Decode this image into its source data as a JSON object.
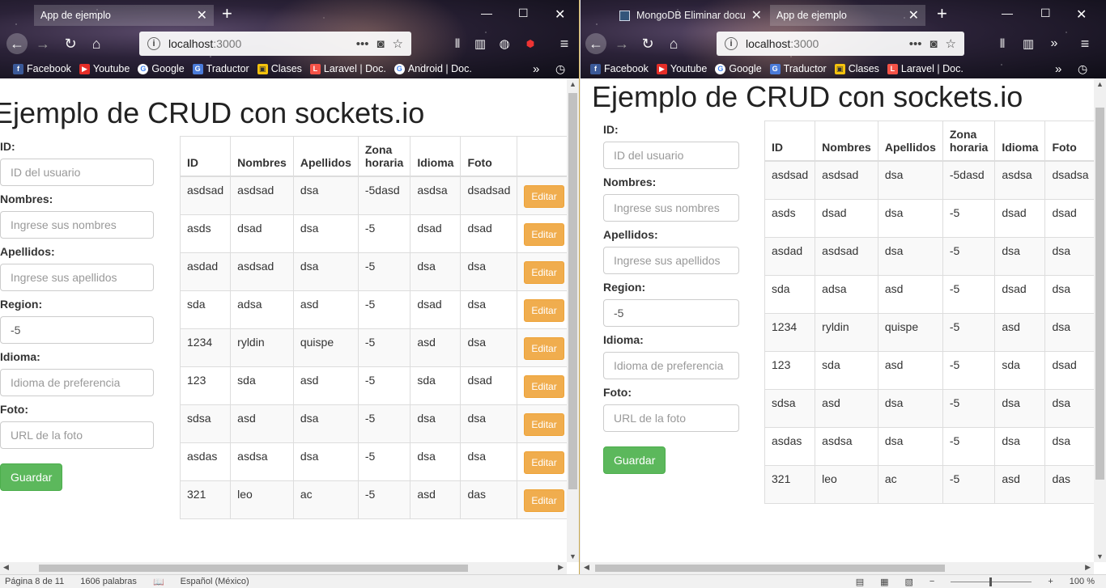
{
  "left": {
    "tab": {
      "label": "App de ejemplo"
    },
    "url": {
      "host": "localhost",
      "port": ":3000"
    }
  },
  "right": {
    "tabs": [
      {
        "label": "MongoDB Eliminar docu"
      },
      {
        "label": "App de ejemplo"
      }
    ],
    "url": {
      "host": "localhost",
      "port": ":3000"
    }
  },
  "bookmarks_left": [
    "Facebook",
    "Youtube",
    "Google",
    "Traductor",
    "Clases",
    "Laravel | Doc.",
    "Android | Doc."
  ],
  "bookmarks_right": [
    "Facebook",
    "Youtube",
    "Google",
    "Traductor",
    "Clases",
    "Laravel | Doc."
  ],
  "page": {
    "title": "Ejemplo de CRUD con sockets.io",
    "form": {
      "id_label": "ID:",
      "id_placeholder": "ID del usuario",
      "nombres_label": "Nombres:",
      "nombres_placeholder": "Ingrese sus nombres",
      "apellidos_label": "Apellidos:",
      "apellidos_placeholder": "Ingrese sus apellidos",
      "region_label": "Region:",
      "region_value": "-5",
      "idioma_label": "Idioma:",
      "idioma_placeholder": "Idioma de preferencia",
      "foto_label": "Foto:",
      "foto_placeholder": "URL de la foto",
      "save_label": "Guardar"
    },
    "table": {
      "headers": [
        "ID",
        "Nombres",
        "Apellidos",
        "Zona horaria",
        "Idioma",
        "Foto"
      ],
      "edit_label": "Editar",
      "rows_left": [
        [
          "asdsad",
          "asdsad",
          "dsa",
          "-5dasd",
          "asdsa",
          "dsadsad"
        ],
        [
          "asds",
          "dsad",
          "dsa",
          "-5",
          "dsad",
          "dsad"
        ],
        [
          "asdad",
          "asdsad",
          "dsa",
          "-5",
          "dsa",
          "dsa"
        ],
        [
          "sda",
          "adsa",
          "asd",
          "-5",
          "dsad",
          "dsa"
        ],
        [
          "1234",
          "ryldin",
          "quispe",
          "-5",
          "asd",
          "dsa"
        ],
        [
          "123",
          "sda",
          "asd",
          "-5",
          "sda",
          "dsad"
        ],
        [
          "sdsa",
          "asd",
          "dsa",
          "-5",
          "dsa",
          "dsa"
        ],
        [
          "asdas",
          "asdsa",
          "dsa",
          "-5",
          "dsa",
          "dsa"
        ],
        [
          "321",
          "leo",
          "ac",
          "-5",
          "asd",
          "das"
        ]
      ],
      "rows_right": [
        [
          "asdsad",
          "asdsad",
          "dsa",
          "-5dasd",
          "asdsa",
          "dsadsa"
        ],
        [
          "asds",
          "dsad",
          "dsa",
          "-5",
          "dsad",
          "dsad"
        ],
        [
          "asdad",
          "asdsad",
          "dsa",
          "-5",
          "dsa",
          "dsa"
        ],
        [
          "sda",
          "adsa",
          "asd",
          "-5",
          "dsad",
          "dsa"
        ],
        [
          "1234",
          "ryldin",
          "quispe",
          "-5",
          "asd",
          "dsa"
        ],
        [
          "123",
          "sda",
          "asd",
          "-5",
          "sda",
          "dsad"
        ],
        [
          "sdsa",
          "asd",
          "dsa",
          "-5",
          "dsa",
          "dsa"
        ],
        [
          "asdas",
          "asdsa",
          "dsa",
          "-5",
          "dsa",
          "dsa"
        ],
        [
          "321",
          "leo",
          "ac",
          "-5",
          "asd",
          "das"
        ]
      ]
    }
  },
  "statusbar": {
    "page": "Página 8 de 11",
    "words": "1606 palabras",
    "language": "Español (México)",
    "zoom": "100 %"
  }
}
